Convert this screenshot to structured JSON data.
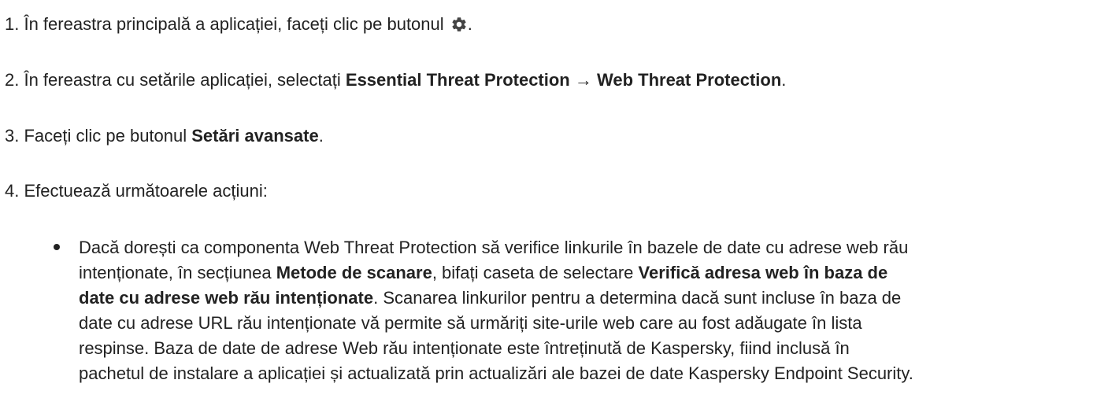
{
  "steps": [
    {
      "prefix": "1. În fereastra principală a aplicației, faceți clic pe butonul ",
      "icon": "gear-icon",
      "suffix": "."
    },
    {
      "prefix": "2. În fereastra cu setările aplicației, selectați ",
      "bold1": "Essential Threat Protection",
      "arrow": " → ",
      "bold2": "Web Threat Protection",
      "suffix": "."
    },
    {
      "prefix": "3. Faceți clic pe butonul ",
      "bold": "Setări avansate",
      "suffix": "."
    },
    {
      "text": "4. Efectuează următoarele acțiuni:"
    }
  ],
  "bullet": {
    "line1": "Dacă dorești ca componenta Web Threat Protection să verifice linkurile în bazele de date cu adrese web rău",
    "line2_a": "intenționate, în secțiunea ",
    "line2_b": "Metode de scanare",
    "line2_c": ", bifați caseta de selectare ",
    "line2_d": "Verifică adresa web în baza de",
    "line3_a": "date cu adrese web rău intenționate",
    "line3_b": ". Scanarea linkurilor pentru a determina dacă sunt incluse în baza de",
    "line4": "date cu adrese URL rău intenționate vă permite să urmăriți site-urile web care au fost adăugate în lista",
    "line5": "respinse. Baza de date de adrese Web rău intenționate este întreținută de Kaspersky, fiind inclusă în",
    "line6": "pachetul de instalare a aplicației și actualizată prin actualizări ale bazei de date Kaspersky Endpoint Security."
  }
}
